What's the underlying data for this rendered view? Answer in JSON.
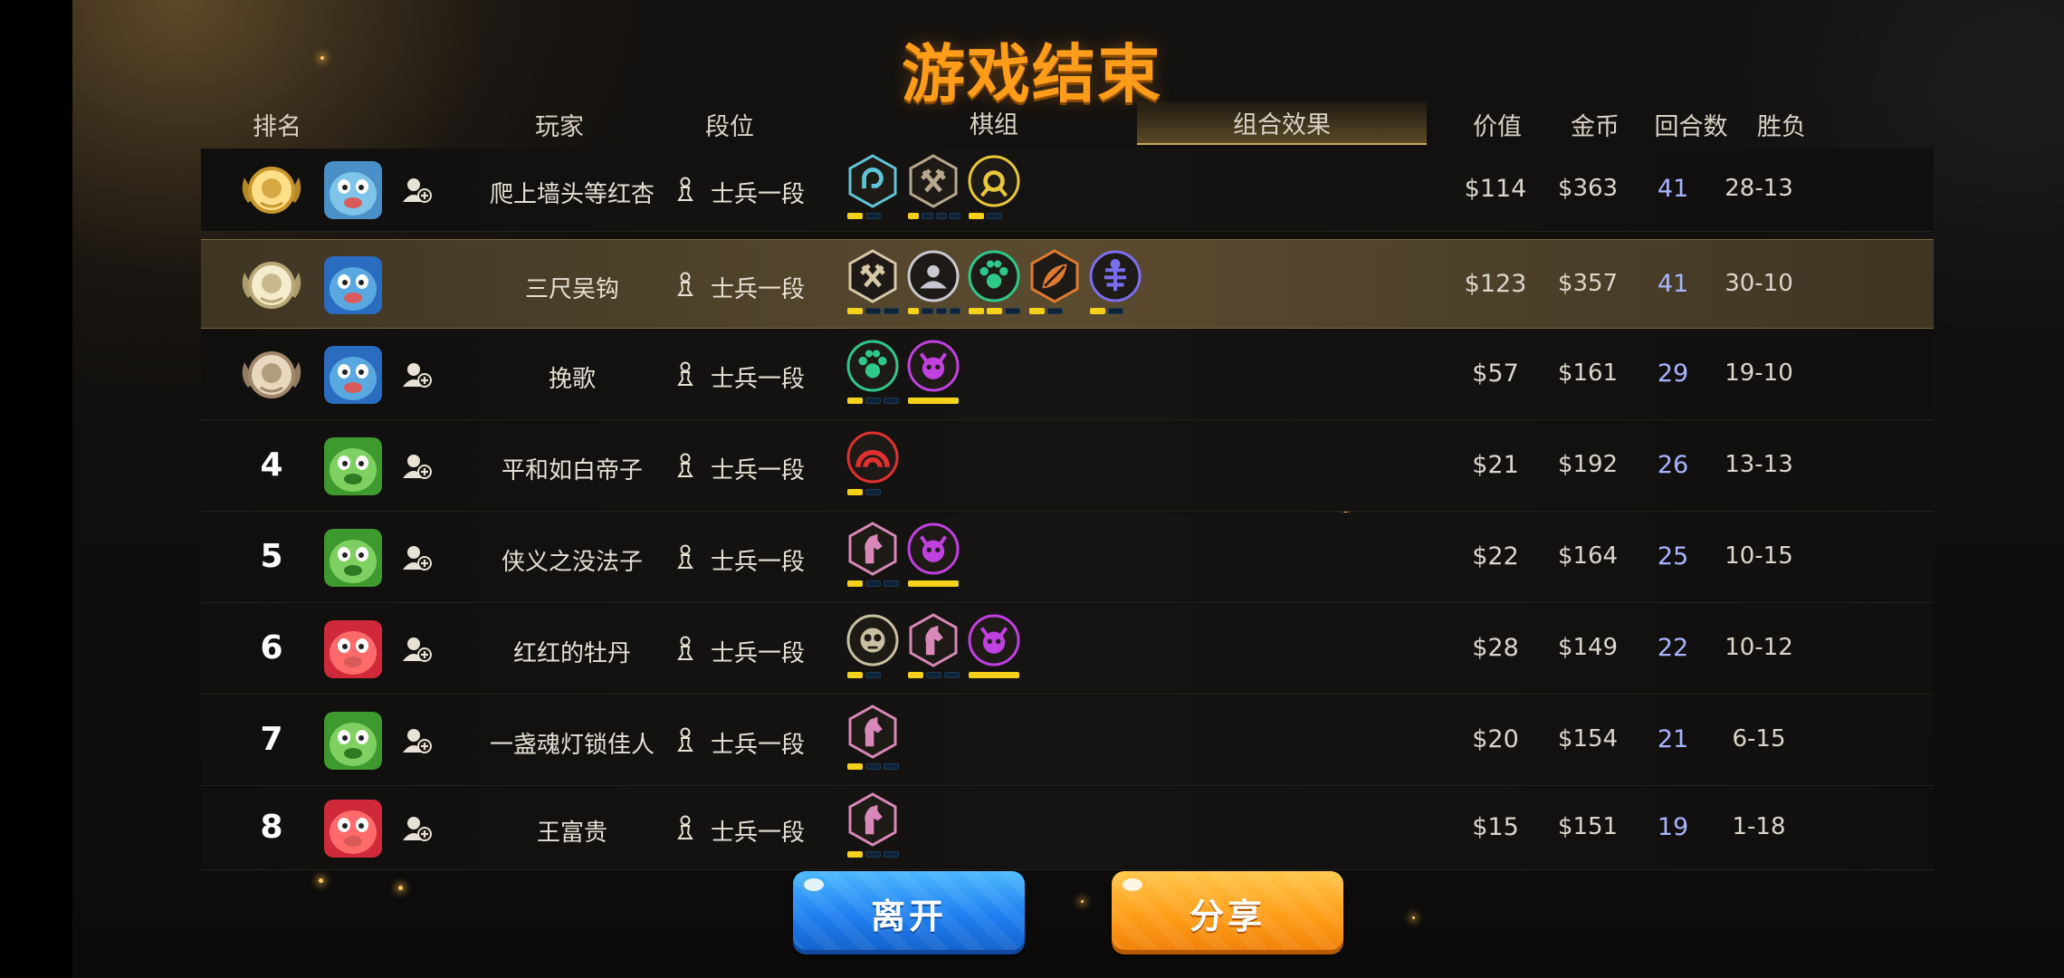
{
  "title": "游戏结束",
  "headers": {
    "rank": "排名",
    "player": "玩家",
    "tier": "段位",
    "pieces": "棋组",
    "combo": "组合效果",
    "value": "价值",
    "gold": "金币",
    "rounds": "回合数",
    "winloss": "胜负"
  },
  "rows": [
    {
      "rank": "1",
      "medal": "gold",
      "avatar": "owl-hat",
      "addFriend": true,
      "name": "爬上墙头等红杏",
      "tier": "士兵一段",
      "synergies": [
        {
          "icon": "mage",
          "color": "#5ec6d8",
          "bars": [
            true,
            false
          ]
        },
        {
          "icon": "warrior",
          "color": "#b8a890",
          "bars": [
            true,
            false,
            false,
            false
          ]
        },
        {
          "icon": "ranger",
          "color": "#e8c83a",
          "bars": [
            true,
            false
          ]
        }
      ],
      "value": "$114",
      "gold": "$363",
      "rounds": "41",
      "wl": "28-13",
      "highlight": false
    },
    {
      "rank": "2",
      "medal": "silver",
      "avatar": "bird",
      "addFriend": false,
      "name": "三尺吴钩",
      "tier": "士兵一段",
      "synergies": [
        {
          "icon": "warrior",
          "color": "#d8c8a8",
          "bars": [
            true,
            false,
            false
          ]
        },
        {
          "icon": "human",
          "color": "#c8c8d0",
          "bars": [
            true,
            false,
            false,
            false
          ]
        },
        {
          "icon": "beast",
          "color": "#2ec88a",
          "bars": [
            true,
            true,
            false
          ]
        },
        {
          "icon": "elf",
          "color": "#e07a30",
          "bars": [
            true,
            false
          ]
        },
        {
          "icon": "naga",
          "color": "#7a6ef0",
          "bars": [
            true,
            false
          ]
        }
      ],
      "value": "$123",
      "gold": "$357",
      "rounds": "41",
      "wl": "30-10",
      "highlight": true
    },
    {
      "rank": "3",
      "medal": "bronze",
      "avatar": "bird",
      "addFriend": true,
      "name": "挽歌",
      "tier": "士兵一段",
      "synergies": [
        {
          "icon": "beast",
          "color": "#2ec88a",
          "bars": [
            true,
            false,
            false
          ]
        },
        {
          "icon": "demon",
          "color": "#c040e0",
          "bars": [
            true
          ]
        }
      ],
      "value": "$57",
      "gold": "$161",
      "rounds": "29",
      "wl": "19-10",
      "highlight": false
    },
    {
      "rank": "4",
      "medal": "",
      "avatar": "green",
      "addFriend": true,
      "name": "平和如白帝子",
      "tier": "士兵一段",
      "synergies": [
        {
          "icon": "ogre",
          "color": "#e03030",
          "bars": [
            true,
            false
          ]
        }
      ],
      "value": "$21",
      "gold": "$192",
      "rounds": "26",
      "wl": "13-13",
      "highlight": false
    },
    {
      "rank": "5",
      "medal": "",
      "avatar": "green",
      "addFriend": true,
      "name": "侠义之没法子",
      "tier": "士兵一段",
      "synergies": [
        {
          "icon": "knight",
          "color": "#d888b8",
          "bars": [
            true,
            false,
            false
          ]
        },
        {
          "icon": "demon",
          "color": "#c040e0",
          "bars": [
            true
          ]
        }
      ],
      "value": "$22",
      "gold": "$164",
      "rounds": "25",
      "wl": "10-15",
      "highlight": false
    },
    {
      "rank": "6",
      "medal": "",
      "avatar": "red",
      "addFriend": true,
      "name": "红红的牡丹",
      "tier": "士兵一段",
      "synergies": [
        {
          "icon": "goblin",
          "color": "#c8c0a0",
          "bars": [
            true,
            false
          ]
        },
        {
          "icon": "knight",
          "color": "#d888b8",
          "bars": [
            true,
            false,
            false
          ]
        },
        {
          "icon": "demon",
          "color": "#c040e0",
          "bars": [
            true
          ]
        }
      ],
      "value": "$28",
      "gold": "$149",
      "rounds": "22",
      "wl": "10-12",
      "highlight": false
    },
    {
      "rank": "7",
      "medal": "",
      "avatar": "green",
      "addFriend": true,
      "name": "一盏魂灯锁佳人",
      "tier": "士兵一段",
      "synergies": [
        {
          "icon": "knight",
          "color": "#d888b8",
          "bars": [
            true,
            false,
            false
          ]
        }
      ],
      "value": "$20",
      "gold": "$154",
      "rounds": "21",
      "wl": "6-15",
      "highlight": false
    },
    {
      "rank": "8",
      "medal": "",
      "avatar": "red",
      "addFriend": true,
      "name": "王富贵",
      "tier": "士兵一段",
      "synergies": [
        {
          "icon": "knight",
          "color": "#d888b8",
          "bars": [
            true,
            false,
            false
          ]
        }
      ],
      "value": "$15",
      "gold": "$151",
      "rounds": "19",
      "wl": "1-18",
      "highlight": false
    }
  ],
  "buttons": {
    "leave": "离开",
    "share": "分享"
  }
}
